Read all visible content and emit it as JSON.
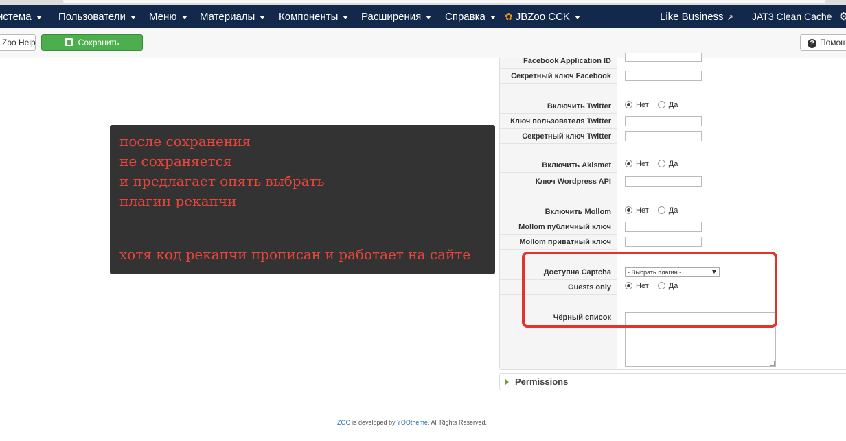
{
  "navbar": {
    "items": [
      {
        "label": "истема",
        "caret": true
      },
      {
        "label": "Пользователи",
        "caret": true
      },
      {
        "label": "Меню",
        "caret": true
      },
      {
        "label": "Материалы",
        "caret": true
      },
      {
        "label": "Компоненты",
        "caret": true
      },
      {
        "label": "Расширения",
        "caret": true
      },
      {
        "label": "Справка",
        "caret": true
      },
      {
        "label": "JBZoo CCK",
        "caret": true,
        "icon": "flame-icon"
      }
    ],
    "right_items": [
      {
        "label": "Like Business",
        "icon": "external-link-icon"
      },
      {
        "label": "JAT3 Clean Cache"
      }
    ],
    "gear_icon": "gear-icon",
    "colors": {
      "background": "#13294b"
    }
  },
  "toolbar": {
    "zoo_help_label": "Zoo Help",
    "save_label": "Сохранить",
    "help_label": "Помощ",
    "colors": {
      "save": "#4cae4c"
    }
  },
  "note": {
    "lines": [
      "после сохранения",
      "не сохраняется",
      "и предлагает опять выбрать",
      "плагин рекапчи",
      "хотя код рекапчи прописан и работает на сайте"
    ],
    "colors": {
      "text": "#e8453c",
      "background": "#333333"
    }
  },
  "form": {
    "facebook_app_id_label": "Facebook Application ID",
    "facebook_secret_label": "Секретный ключ Facebook",
    "twitter_enable_label": "Включить Twitter",
    "twitter_user_key_label": "Ключ пользователя Twitter",
    "twitter_secret_label": "Секретный ключ Twitter",
    "akismet_enable_label": "Включить Akismet",
    "wordpress_api_label": "Ключ Wordpress API",
    "mollom_enable_label": "Включить Mollom",
    "mollom_public_label": "Mollom публичный ключ",
    "mollom_private_label": "Mollom приватный ключ",
    "captcha_label": "Доступна Captcha",
    "captcha_selected": "- Выбрать плагин -",
    "guests_only_label": "Guests only",
    "blacklist_label": "Чёрный список",
    "radio_no": "Нет",
    "radio_yes": "Да"
  },
  "permissions": {
    "label": "Permissions"
  },
  "footer": {
    "zoo_link": "ZOO",
    "text_middle": " is developed by ",
    "yootheme_link": "YOOtheme",
    "text_end": ". All Rights Reserved."
  },
  "highlight_color": "#e2342b"
}
